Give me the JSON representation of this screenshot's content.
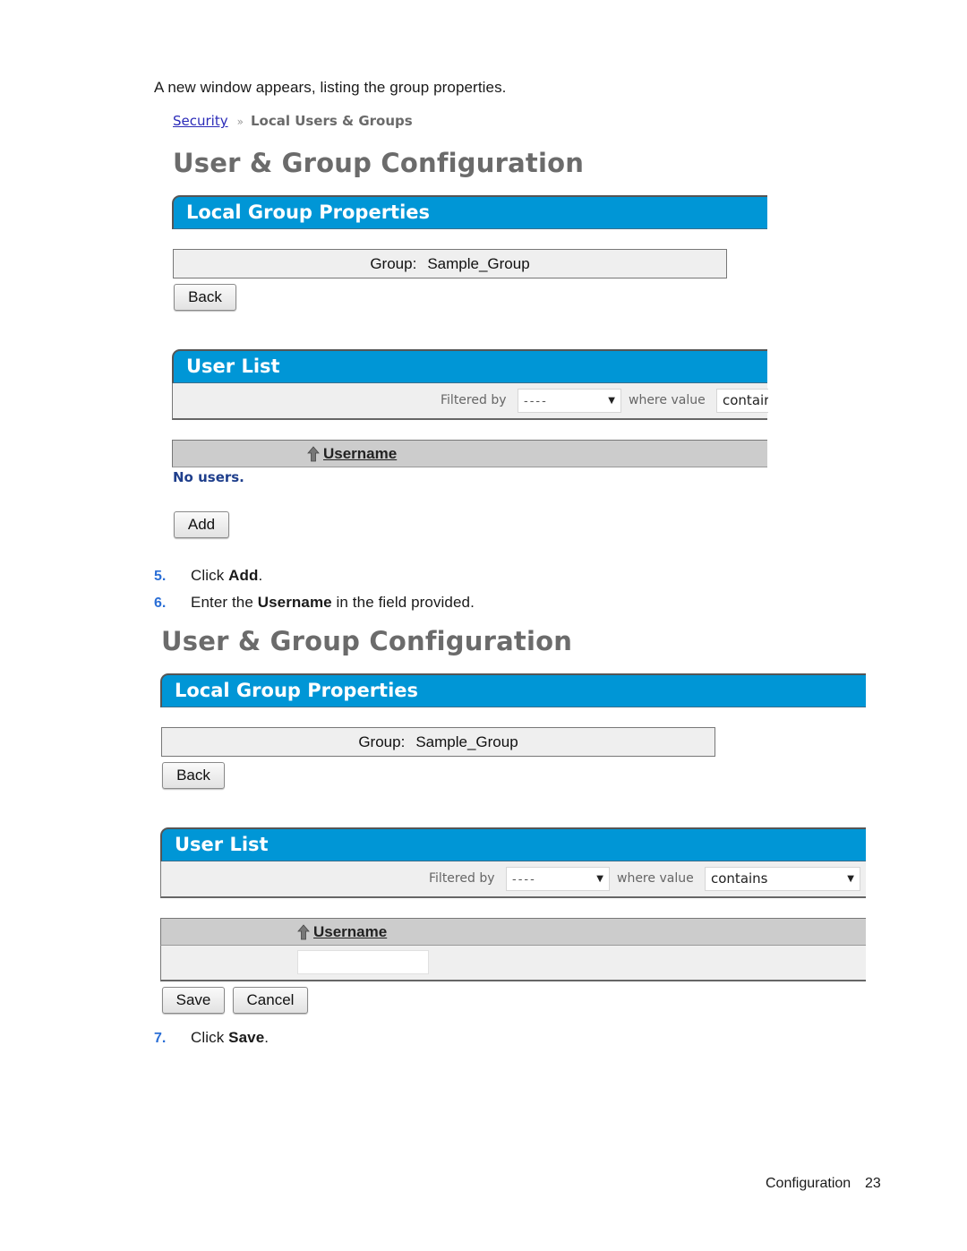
{
  "intro_text": "A new window appears, listing the group properties.",
  "screenshot1": {
    "breadcrumb": {
      "link": "Security",
      "separator": "»",
      "current": "Local Users & Groups"
    },
    "page_title": "User & Group Configuration",
    "group_panel": {
      "title": "Local Group Properties",
      "group_label": "Group:",
      "group_value": "Sample_Group",
      "back_button": "Back"
    },
    "user_list": {
      "title": "User List",
      "filtered_by_label": "Filtered by",
      "filter_field_value": "----",
      "where_value_label": "where value",
      "condition_value": "contair",
      "column_header": "Username",
      "empty_message": "No users.",
      "add_button": "Add"
    }
  },
  "steps": [
    {
      "number": "5.",
      "prefix": "Click ",
      "bold": "Add",
      "suffix": "."
    },
    {
      "number": "6.",
      "prefix": "Enter the ",
      "bold": "Username",
      "suffix": " in the field provided."
    },
    {
      "number": "7.",
      "prefix": "Click ",
      "bold": "Save",
      "suffix": "."
    }
  ],
  "screenshot2": {
    "page_title": "User & Group Configuration",
    "group_panel": {
      "title": "Local Group Properties",
      "group_label": "Group:",
      "group_value": "Sample_Group",
      "back_button": "Back"
    },
    "user_list": {
      "title": "User List",
      "filtered_by_label": "Filtered by",
      "filter_field_value": "----",
      "where_value_label": "where value",
      "condition_value": "contains",
      "column_header": "Username",
      "username_input_value": "",
      "save_button": "Save",
      "cancel_button": "Cancel"
    }
  },
  "footer": {
    "section": "Configuration",
    "page_number": "23"
  },
  "colors": {
    "panel_header": "#0096d6",
    "step_number": "#2b6fd6",
    "title_gray": "#6b6b6b",
    "link": "#2a2ab8",
    "empty_message": "#1f3f8c"
  }
}
